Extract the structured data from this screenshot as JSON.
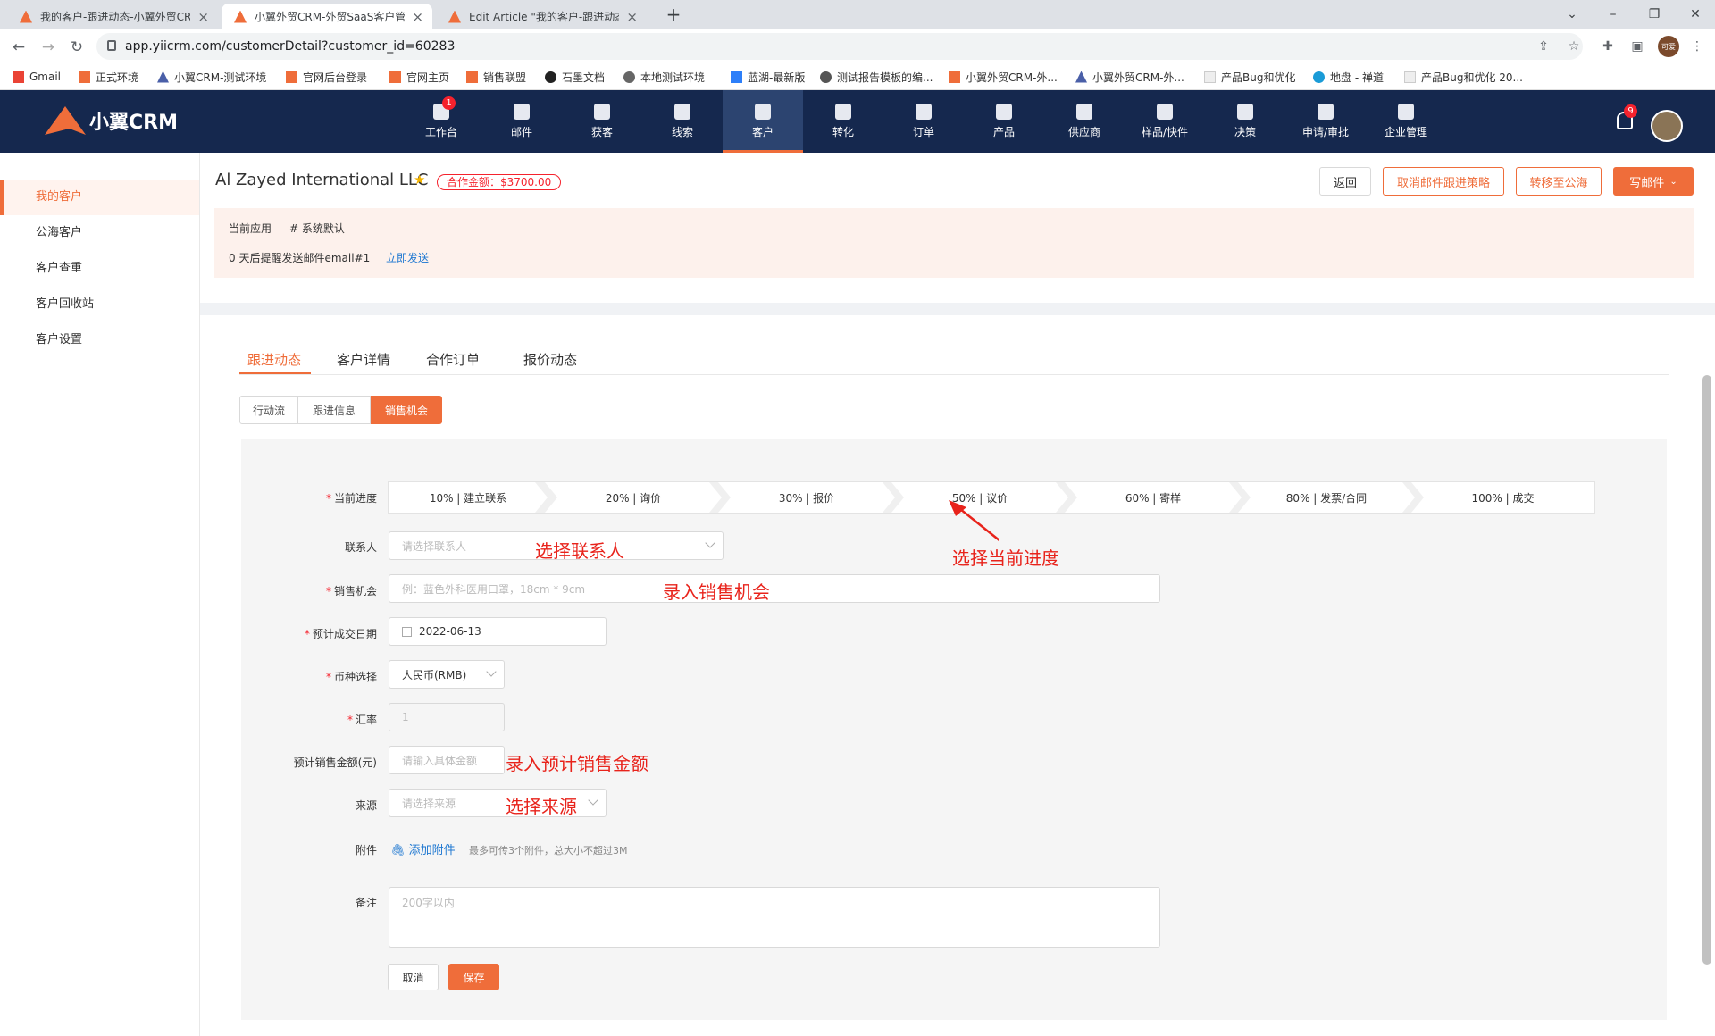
{
  "browser": {
    "tabs": [
      {
        "title": "我的客户-跟进动态-小翼外贸CRM"
      },
      {
        "title": "小翼外贸CRM-外贸SaaS客户管理"
      },
      {
        "title": "Edit Article \"我的客户-跟进动态"
      }
    ],
    "url": "app.yiicrm.com/customerDetail?customer_id=60283",
    "profile": "可爱",
    "bookmarks": [
      "Gmail",
      "正式环境",
      "小翼CRM-测试环境",
      "官网后台登录",
      "官网主页",
      "销售联盟",
      "石墨文档",
      "本地测试环境",
      "蓝湖-最新版",
      "测试报告模板的编...",
      "小翼外贸CRM-外...",
      "小翼外贸CRM-外...",
      "产品Bug和优化",
      "地盘 - 禅道",
      "产品Bug和优化 20..."
    ]
  },
  "app": {
    "logo_text": "小翼CRM",
    "nav": [
      {
        "label": "工作台",
        "icon": "workbench-icon",
        "badge": "1"
      },
      {
        "label": "邮件",
        "icon": "mail-icon"
      },
      {
        "label": "获客",
        "icon": "acquire-icon"
      },
      {
        "label": "线索",
        "icon": "leads-icon"
      },
      {
        "label": "客户",
        "icon": "customer-icon",
        "active": true
      },
      {
        "label": "转化",
        "icon": "funnel-icon"
      },
      {
        "label": "订单",
        "icon": "order-icon"
      },
      {
        "label": "产品",
        "icon": "product-icon"
      },
      {
        "label": "供应商",
        "icon": "supplier-icon"
      },
      {
        "label": "样品/快件",
        "icon": "sample-icon"
      },
      {
        "label": "决策",
        "icon": "decision-icon"
      },
      {
        "label": "申请/审批",
        "icon": "approval-icon"
      },
      {
        "label": "企业管理",
        "icon": "company-icon"
      }
    ],
    "notification_badge": "9"
  },
  "sidebar": {
    "items": [
      {
        "label": "我的客户",
        "active": true
      },
      {
        "label": "公海客户"
      },
      {
        "label": "客户查重"
      },
      {
        "label": "客户回收站"
      },
      {
        "label": "客户设置"
      }
    ]
  },
  "customer": {
    "name": "Al Zayed International LLC",
    "amount_tag": "合作金额：$3700.00",
    "buttons": {
      "back": "返回",
      "cancel_strategy": "取消邮件跟进策略",
      "move_to_pool": "转移至公海",
      "write_mail": "写邮件"
    },
    "info": {
      "app_label": "当前应用",
      "app_value": "# 系统默认",
      "reminder": "0 天后提醒发送邮件email#1",
      "send_now": "立即发送"
    }
  },
  "tabs": [
    "跟进动态",
    "客户详情",
    "合作订单",
    "报价动态"
  ],
  "segments": [
    "行动流",
    "跟进信息",
    "销售机会"
  ],
  "form": {
    "progress_label": "当前进度",
    "steps": [
      "10% | 建立联系",
      "20% | 询价",
      "30% | 报价",
      "50% | 议价",
      "60% | 寄样",
      "80% | 发票/合同",
      "100% | 成交"
    ],
    "contact_label": "联系人",
    "contact_placeholder": "请选择联系人",
    "opportunity_label": "销售机会",
    "opportunity_placeholder": "例：蓝色外科医用口罩，18cm * 9cm",
    "date_label": "预计成交日期",
    "date_value": "2022-06-13",
    "currency_label": "币种选择",
    "currency_value": "人民币(RMB)",
    "rate_label": "汇率",
    "rate_value": "1",
    "amount_label": "预计销售金额(元)",
    "amount_placeholder": "请输入具体金额",
    "source_label": "来源",
    "source_placeholder": "请选择来源",
    "attach_label": "附件",
    "attach_link": "添加附件",
    "attach_hint": "最多可传3个附件，总大小不超过3M",
    "note_label": "备注",
    "note_placeholder": "200字以内",
    "cancel": "取消",
    "save": "保存"
  },
  "annotations": {
    "progress": "选择当前进度",
    "contact": "选择联系人",
    "opportunity": "录入销售机会",
    "amount": "录入预计销售金额",
    "source": "选择来源"
  },
  "colors": {
    "accent": "#ef6d3a",
    "header": "#15284e",
    "annotation": "#e8231b"
  }
}
